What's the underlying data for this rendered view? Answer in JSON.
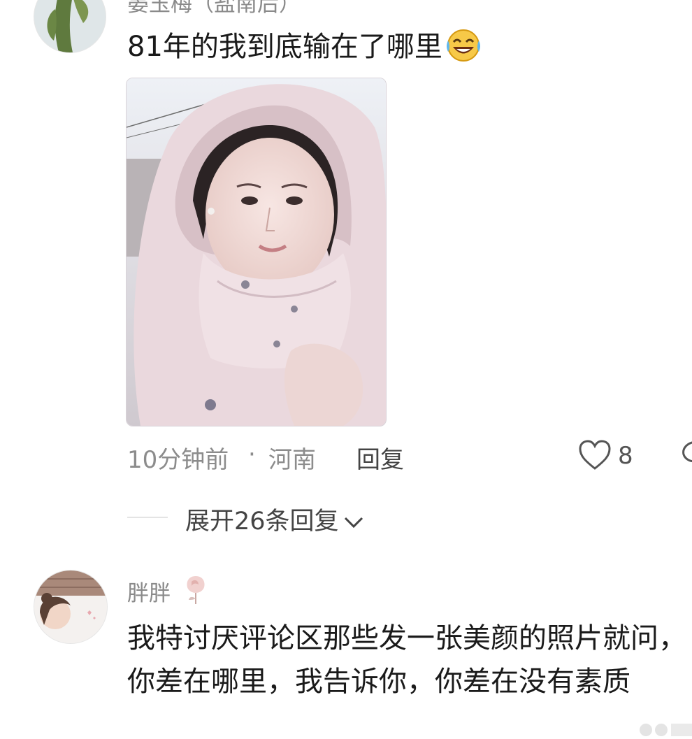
{
  "comment1": {
    "username": "晏玉梅（盐南后）",
    "text": "81年的我到底输在了哪里",
    "emoji": "laughing-tears-emoji",
    "photo_alt": "selfie photo",
    "time": "10分钟前",
    "separator": "·",
    "location": "河南",
    "reply_label": "回复",
    "like_count": "8",
    "expand_replies": "展开26条回复"
  },
  "comment2": {
    "username": "胖胖",
    "badge_icon": "rose-icon",
    "text": "我特讨厌评论区那些发一张美颜的照片就问，你差在哪里，我告诉你，你差在没有素质"
  },
  "colors": {
    "text_primary": "#1a1a1a",
    "text_secondary": "#8a8a8a",
    "background": "#ffffff"
  }
}
